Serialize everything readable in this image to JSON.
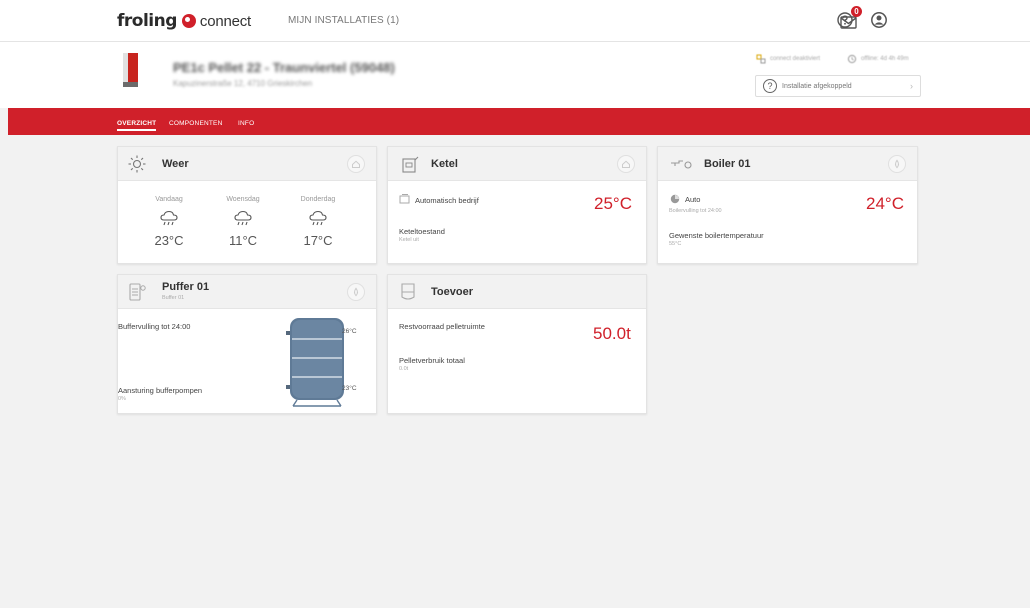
{
  "brand": {
    "name_part1": "froling",
    "name_part2": "connect",
    "accent_color": "#d0202a"
  },
  "topnav": {
    "installations_link": "MIJN INSTALLATIES (1)",
    "messages_badge": "0",
    "icons": [
      "help-icon",
      "mail-icon",
      "account-icon"
    ]
  },
  "installation": {
    "title": "PE1c Pellet 22 - Traunviertel (59048)",
    "subtitle": "Kapuzinerstraße 12, 4710 Grieskirchen",
    "connect_status": "connect deaktiviert",
    "offline_status": "offline: 4d 4h 49m",
    "disconnected_label": "Installatie afgekoppeld"
  },
  "tabs": [
    {
      "label": "OVERZICHT",
      "active": true
    },
    {
      "label": "COMPONENTEN",
      "active": false
    },
    {
      "label": "INFO",
      "active": false
    }
  ],
  "weather": {
    "title": "Weer",
    "days": [
      {
        "day": "Vandaag",
        "temp": "23°C",
        "icon": "cloud-rain-icon"
      },
      {
        "day": "Woensdag",
        "temp": "11°C",
        "icon": "cloud-rain-icon"
      },
      {
        "day": "Donderdag",
        "temp": "17°C",
        "icon": "cloud-rain-icon"
      }
    ]
  },
  "ketel": {
    "title": "Ketel",
    "mode": "Automatisch bedrijf",
    "temp": "25°C",
    "state_label": "Keteltoestand",
    "state_value": "Ketel uit"
  },
  "boiler": {
    "title": "Boiler 01",
    "mode": "Auto",
    "mode_sub": "Boilervulling tot 24:00",
    "temp": "24°C",
    "setpoint_label": "Gewenste boilertemperatuur",
    "setpoint_value": "55°C"
  },
  "puffer": {
    "title": "Puffer 01",
    "subtitle": "Buffer 01",
    "fill_label": "Buffervulling tot 24:00",
    "pump_label": "Aansturing bufferpompen",
    "pump_value": "0%",
    "temp_top": "26°C",
    "temp_bottom": "23°C"
  },
  "toevoer": {
    "title": "Toevoer",
    "stock_label": "Restvoorraad pelletruimte",
    "stock_value": "50.0t",
    "usage_label": "Pelletverbruik totaal",
    "usage_value": "0.0t"
  }
}
